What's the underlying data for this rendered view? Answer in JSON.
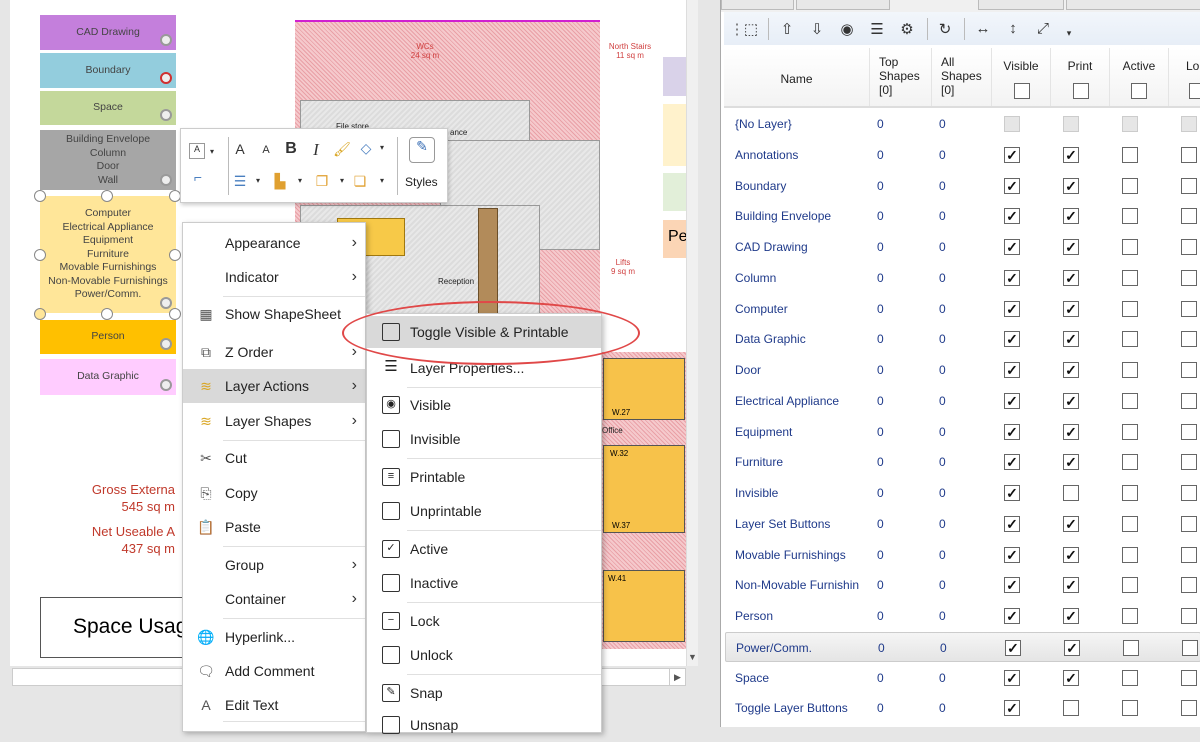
{
  "canvas": {
    "legend": [
      {
        "label": "CAD Drawing",
        "color": "#c47fdc"
      },
      {
        "label": "Boundary",
        "color": "#93cddd"
      },
      {
        "label": "Space",
        "color": "#c4d89b"
      },
      {
        "label": "Building Envelope\nColumn\nDoor\nWall",
        "color": "#a6a6a6"
      },
      {
        "label": "Computer\nElectrical Appliance\nEquipment\nFurniture\nMovable Furnishings\nNon-Movable Furnishings\nPower/Comm.",
        "color": "#ffe699"
      },
      {
        "label": "Person",
        "color": "#ffc000"
      },
      {
        "label": "Data Graphic",
        "color": "#ffccff"
      }
    ],
    "floorplan": {
      "wcs": "WCs",
      "wcs_area": "24 sq m",
      "north_stairs": "North Stairs",
      "north_stairs_area": "11 sq m",
      "lifts": "Lifts",
      "lifts_area": "9 sq m",
      "file_store": "File store",
      "ance": "ance",
      "reception": "Reception",
      "office": "Office",
      "rooms": [
        "W.27",
        "W.32",
        "W.37",
        "W.41"
      ]
    },
    "gross_label": "Gross Externa",
    "gross_value": "545 sq m",
    "net_label": "Net Useable A",
    "net_value": "437 sq m",
    "title_box": "Space Usag",
    "side_tab_text": "Pe"
  },
  "mini_toolbar": {
    "styles_label": "Styles"
  },
  "context_menu": [
    {
      "label": "Appearance",
      "icon": "none",
      "submenu": true
    },
    {
      "label": "Indicator",
      "icon": "none",
      "submenu": true
    },
    {
      "label": "Show ShapeSheet",
      "icon": "shapesheet-icon",
      "submenu": false
    },
    {
      "label": "Z Order",
      "icon": "z-order-icon",
      "submenu": true
    },
    {
      "label": "Layer Actions",
      "icon": "layers-icon",
      "submenu": true,
      "highlighted": true
    },
    {
      "label": "Layer Shapes",
      "icon": "layer-shapes-icon",
      "submenu": true
    },
    {
      "label": "Cut",
      "icon": "scissors-icon",
      "submenu": false
    },
    {
      "label": "Copy",
      "icon": "copy-icon",
      "submenu": false
    },
    {
      "label": "Paste",
      "icon": "paste-icon",
      "submenu": false
    },
    {
      "label": "Group",
      "icon": "none",
      "submenu": true
    },
    {
      "label": "Container",
      "icon": "none",
      "submenu": true
    },
    {
      "label": "Hyperlink...",
      "icon": "globe-link-icon",
      "submenu": false
    },
    {
      "label": "Add Comment",
      "icon": "comment-icon",
      "submenu": false
    },
    {
      "label": "Edit Text",
      "icon": "text-a-icon",
      "submenu": false
    }
  ],
  "layer_actions_menu": [
    {
      "label": "Toggle Visible & Printable",
      "icon": "toggle-icon",
      "highlighted": true
    },
    {
      "label": "Layer Properties...",
      "icon": "list-icon"
    },
    {
      "label": "Visible",
      "icon": "eye-icon"
    },
    {
      "label": "Invisible",
      "icon": "empty-box-icon"
    },
    {
      "label": "Printable",
      "icon": "printable-icon"
    },
    {
      "label": "Unprintable",
      "icon": "empty-box-icon"
    },
    {
      "label": "Active",
      "icon": "checked-box-icon"
    },
    {
      "label": "Inactive",
      "icon": "empty-box-icon"
    },
    {
      "label": "Lock",
      "icon": "lock-box-icon"
    },
    {
      "label": "Unlock",
      "icon": "empty-box-icon"
    },
    {
      "label": "Snap",
      "icon": "snap-icon"
    },
    {
      "label": "Unsnap",
      "icon": "empty-box-icon"
    }
  ],
  "layers_panel": {
    "columns": {
      "name": "Name",
      "top_shapes": "Top Shapes",
      "top_count": "[0]",
      "all_shapes": "All Shapes",
      "all_count": "[0]",
      "visible": "Visible",
      "print": "Print",
      "active": "Active",
      "lock": "Lo"
    },
    "rows": [
      {
        "name": "{No Layer}",
        "top": "0",
        "all": "0",
        "visible": null,
        "print": null,
        "active": null,
        "lock": null
      },
      {
        "name": "Annotations",
        "top": "0",
        "all": "0",
        "visible": true,
        "print": true,
        "active": false,
        "lock": false
      },
      {
        "name": "Boundary",
        "top": "0",
        "all": "0",
        "visible": true,
        "print": true,
        "active": false,
        "lock": false
      },
      {
        "name": "Building Envelope",
        "top": "0",
        "all": "0",
        "visible": true,
        "print": true,
        "active": false,
        "lock": false
      },
      {
        "name": "CAD Drawing",
        "top": "0",
        "all": "0",
        "visible": true,
        "print": true,
        "active": false,
        "lock": false
      },
      {
        "name": "Column",
        "top": "0",
        "all": "0",
        "visible": true,
        "print": true,
        "active": false,
        "lock": false
      },
      {
        "name": "Computer",
        "top": "0",
        "all": "0",
        "visible": true,
        "print": true,
        "active": false,
        "lock": false
      },
      {
        "name": "Data Graphic",
        "top": "0",
        "all": "0",
        "visible": true,
        "print": true,
        "active": false,
        "lock": false
      },
      {
        "name": "Door",
        "top": "0",
        "all": "0",
        "visible": true,
        "print": true,
        "active": false,
        "lock": false
      },
      {
        "name": "Electrical Appliance",
        "top": "0",
        "all": "0",
        "visible": true,
        "print": true,
        "active": false,
        "lock": false
      },
      {
        "name": "Equipment",
        "top": "0",
        "all": "0",
        "visible": true,
        "print": true,
        "active": false,
        "lock": false
      },
      {
        "name": "Furniture",
        "top": "0",
        "all": "0",
        "visible": true,
        "print": true,
        "active": false,
        "lock": false
      },
      {
        "name": "Invisible",
        "top": "0",
        "all": "0",
        "visible": true,
        "print": false,
        "active": false,
        "lock": false
      },
      {
        "name": "Layer Set Buttons",
        "top": "0",
        "all": "0",
        "visible": true,
        "print": true,
        "active": false,
        "lock": false
      },
      {
        "name": "Movable Furnishings",
        "top": "0",
        "all": "0",
        "visible": true,
        "print": true,
        "active": false,
        "lock": false
      },
      {
        "name": "Non-Movable Furnishin",
        "top": "0",
        "all": "0",
        "visible": true,
        "print": true,
        "active": false,
        "lock": false
      },
      {
        "name": "Person",
        "top": "0",
        "all": "0",
        "visible": true,
        "print": true,
        "active": false,
        "lock": false
      },
      {
        "name": "Power/Comm.",
        "top": "0",
        "all": "0",
        "visible": true,
        "print": true,
        "active": false,
        "lock": false,
        "selected": true
      },
      {
        "name": "Space",
        "top": "0",
        "all": "0",
        "visible": true,
        "print": true,
        "active": false,
        "lock": false
      },
      {
        "name": "Toggle Layer Buttons",
        "top": "0",
        "all": "0",
        "visible": true,
        "print": false,
        "active": false,
        "lock": false
      }
    ]
  }
}
